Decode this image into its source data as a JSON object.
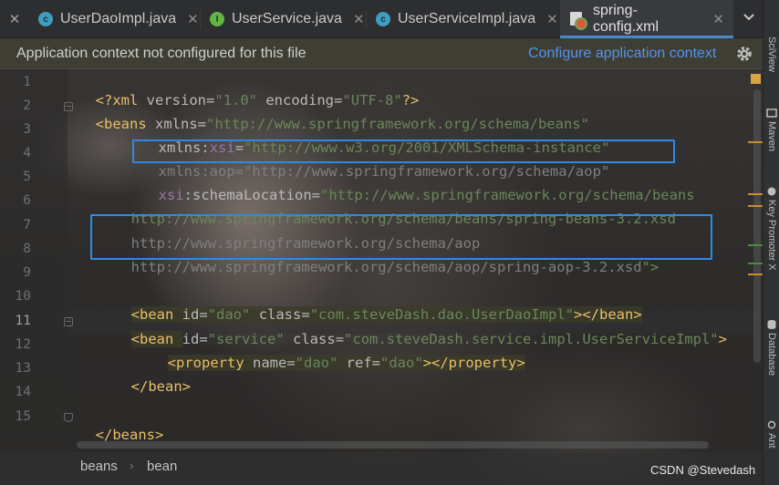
{
  "tabs": [
    {
      "label": "UserDaoImpl.java",
      "icon": "class-icon",
      "active": false
    },
    {
      "label": "UserService.java",
      "icon": "interface-icon",
      "active": false
    },
    {
      "label": "UserServiceImpl.java",
      "icon": "class-icon",
      "active": false
    },
    {
      "label": "spring-config.xml",
      "icon": "xml-file-icon",
      "active": true
    }
  ],
  "tab_close_glyph": "✕",
  "tab_menu_glyph": "⌄",
  "banner": {
    "message": "Application context not configured for this file",
    "link": "Configure application context"
  },
  "right_tools": [
    "SciView",
    "Maven",
    "Key Promoter X",
    "Database",
    "Ant"
  ],
  "line_numbers": [
    "1",
    "2",
    "3",
    "4",
    "5",
    "6",
    "7",
    "8",
    "9",
    "10",
    "11",
    "12",
    "13",
    "14",
    "15"
  ],
  "current_line": "11",
  "code": {
    "l1": {
      "a": "<?xml ",
      "b": "version",
      "c": "=",
      "d": "\"1.0\"",
      "e": " encoding",
      "f": "=",
      "g": "\"UTF-8\"",
      "h": "?>"
    },
    "l2": {
      "a": "<beans ",
      "b": "xmlns",
      "c": "=",
      "d": "\"http://www.springframework.org/schema/beans\""
    },
    "l3": {
      "a": "xmlns",
      "b": ":",
      "c": "xsi",
      "d": "=",
      "e": "\"http://www.w3.org/2001/XMLSchema-instance\""
    },
    "l4": {
      "a": "xmlns:aop=\"http://www.springframework.org/schema/aop\""
    },
    "l5": {
      "a": "xsi",
      "b": ":schemaLocation",
      "c": "=",
      "d": "\"http://www.springframework.org/schema/beans"
    },
    "l6": {
      "a": "http://www.springframework.org/schema/beans/spring-beans-3.2.xsd"
    },
    "l7": {
      "a": "http://www.springframework.org/schema/aop"
    },
    "l8": {
      "a": "http://www.springframework.org/schema/aop/spring-aop-3.2.xsd",
      "b": "\">"
    },
    "l10": {
      "a": "<bean ",
      "b": "id",
      "c": "=",
      "d": "\"dao\"",
      "e": " class",
      "f": "=",
      "g": "\"com.steveDash.dao.UserDaoImpl\"",
      "h": "></bean>"
    },
    "l11": {
      "a": "<bean ",
      "b": "id",
      "c": "=",
      "d": "\"service\"",
      "e": " class",
      "f": "=",
      "g": "\"com.steveDash.service.impl.UserServiceImpl\"",
      "h": ">"
    },
    "l12": {
      "a": "<property ",
      "b": "name",
      "c": "=",
      "d": "\"dao\"",
      "e": " ref",
      "f": "=",
      "g": "\"dao\"",
      "h": "></property>"
    },
    "l13": {
      "a": "</bean>"
    },
    "l15": {
      "a": "</beans>"
    }
  },
  "breadcrumb": [
    "beans",
    "bean"
  ],
  "breadcrumb_sep": "›",
  "watermark": "CSDN @Stevedash",
  "colors": {
    "tag": "#e8bf6a",
    "string": "#6a8759",
    "namespace": "#9876aa",
    "link": "#5394ec",
    "selection_box": "#2e8ae6",
    "active_tab_underline": "#4a88c7"
  }
}
